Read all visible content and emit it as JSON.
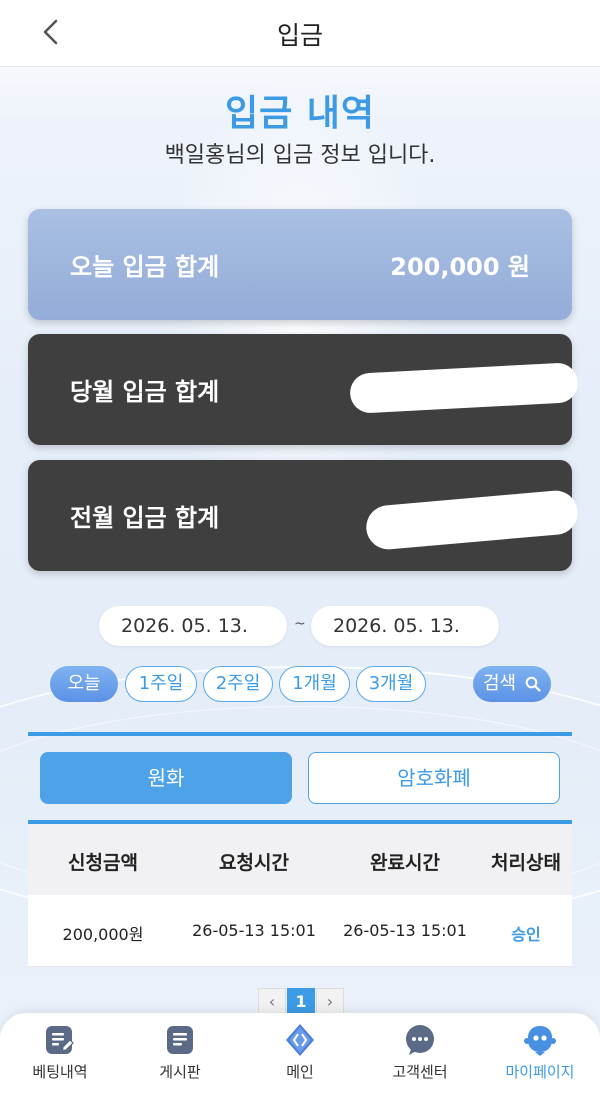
{
  "header": {
    "title": "입금"
  },
  "page": {
    "title": "입금 내역",
    "subtitle": "백일홍님의 입금 정보 입니다."
  },
  "summary": {
    "today_label": "오늘 입금 합계",
    "today_value": "200,000 원",
    "month_label": "당월 입금 합계",
    "prev_month_label": "전월 입금 합계"
  },
  "date_range": {
    "from": "2026. 05. 13.",
    "separator": "~",
    "to": "2026. 05. 13."
  },
  "periods": [
    "오늘",
    "1주일",
    "2주일",
    "1개월",
    "3개월"
  ],
  "search_label": "검색",
  "tabs": {
    "krw": "원화",
    "crypto": "암호화폐"
  },
  "table": {
    "headers": [
      "신청금액",
      "요청시간",
      "완료시간",
      "처리상태"
    ],
    "rows": [
      {
        "amount": "200,000원",
        "requested": "26-05-13 15:01",
        "completed": "26-05-13 15:01",
        "status": "승인"
      }
    ]
  },
  "pagination": {
    "current": "1",
    "prev": "‹",
    "next": "›"
  },
  "nav": {
    "items": [
      {
        "label": "베팅내역",
        "icon": "betting-history-icon"
      },
      {
        "label": "게시판",
        "icon": "board-icon"
      },
      {
        "label": "메인",
        "icon": "main-icon"
      },
      {
        "label": "고객센터",
        "icon": "chat-icon"
      },
      {
        "label": "마이페이지",
        "icon": "mypage-icon"
      }
    ],
    "active": "마이페이지"
  },
  "colors": {
    "accent": "#3d9be6",
    "dark_card": "#3f3f3f",
    "today_card": "#a3b9e0"
  }
}
